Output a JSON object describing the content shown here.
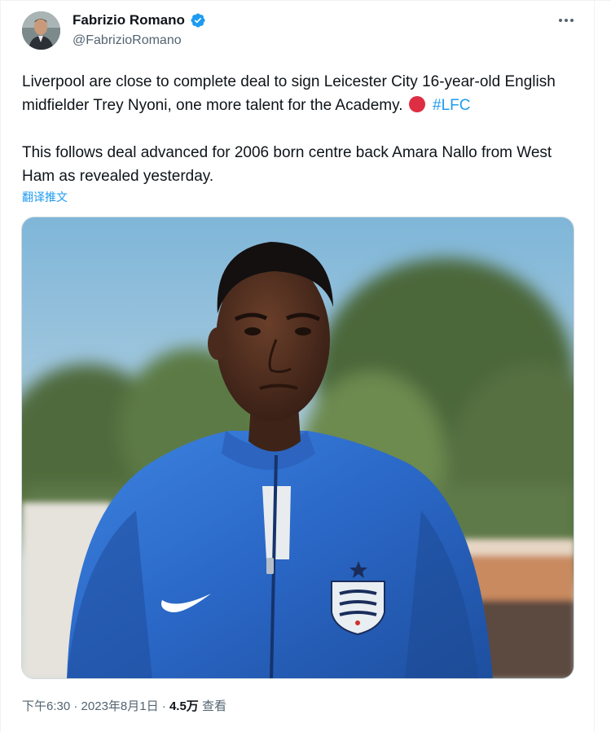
{
  "tweet": {
    "display_name": "Fabrizio Romano",
    "handle": "@FabrizioRomano",
    "text_line1": "Liverpool are close to complete deal to sign Leicester City 16-year-old English midfielder Trey Nyoni, one more talent for the Academy.",
    "hashtag": "#LFC",
    "text_line2": "This follows deal advanced for 2006 born centre back Amara Nallo from West Ham as revealed yesterday.",
    "translate_label": "翻译推文",
    "time": "下午6:30",
    "date": "2023年8月1日",
    "views_count": "4.5万",
    "views_label": "查看",
    "separator": " · "
  },
  "icons": {
    "verified": "verified-badge-icon",
    "more": "more-options-icon",
    "red_circle": "red-circle-emoji"
  },
  "colors": {
    "link": "#1d9bf0",
    "secondary_text": "#536471",
    "primary_text": "#0f1419",
    "emoji_red": "#dd2e44",
    "jacket_blue": "#2f6fd0"
  }
}
